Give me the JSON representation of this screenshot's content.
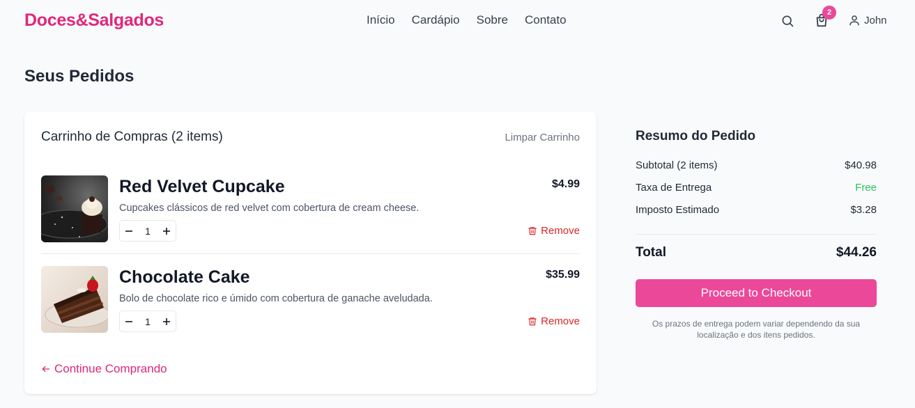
{
  "header": {
    "logo": "Doces&Salgados",
    "nav": [
      "Início",
      "Cardápio",
      "Sobre",
      "Contato"
    ],
    "cart_count": "2",
    "user_name": "John"
  },
  "page_title": "Seus Pedidos",
  "cart": {
    "title": "Carrinho de Compras (2 items)",
    "clear_label": "Limpar Carrinho",
    "items": [
      {
        "name": "Red Velvet Cupcake",
        "description": "Cupcakes clássicos de red velvet com cobertura de cream cheese.",
        "price": "$4.99",
        "quantity": "1",
        "remove_label": "Remove",
        "image_icon": "cupcake-photo"
      },
      {
        "name": "Chocolate Cake",
        "description": "Bolo de chocolate rico e úmido com cobertura de ganache aveludada.",
        "price": "$35.99",
        "quantity": "1",
        "remove_label": "Remove",
        "image_icon": "chocolate-cake-photo"
      }
    ],
    "continue_label": "Continue Comprando"
  },
  "summary": {
    "title": "Resumo do Pedido",
    "rows": [
      {
        "label": "Subtotal (2 items)",
        "value": "$40.98"
      },
      {
        "label": "Taxa de Entrega",
        "value": "Free"
      },
      {
        "label": "Imposto Estimado",
        "value": "$3.28"
      }
    ],
    "total_label": "Total",
    "total_value": "$44.26",
    "checkout_label": "Proceed to Checkout",
    "note": "Os prazos de entrega podem variar dependendo da sua localização e dos itens pedidos."
  },
  "colors": {
    "brand": "#e0287a",
    "accent": "#ec4899",
    "remove": "#dc2626",
    "free": "#22c55e"
  }
}
